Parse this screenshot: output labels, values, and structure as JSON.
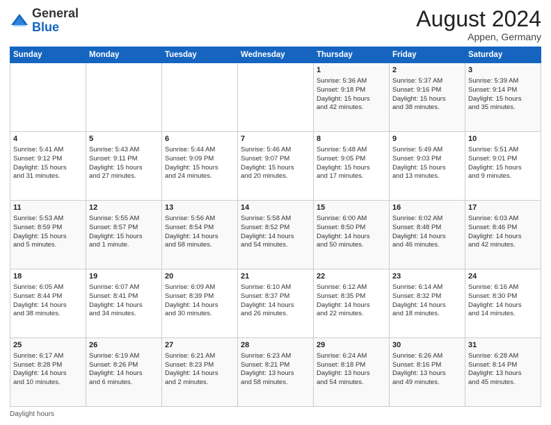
{
  "header": {
    "logo_general": "General",
    "logo_blue": "Blue",
    "month_year": "August 2024",
    "location": "Appen, Germany"
  },
  "days_of_week": [
    "Sunday",
    "Monday",
    "Tuesday",
    "Wednesday",
    "Thursday",
    "Friday",
    "Saturday"
  ],
  "weeks": [
    [
      {
        "day": "",
        "info": ""
      },
      {
        "day": "",
        "info": ""
      },
      {
        "day": "",
        "info": ""
      },
      {
        "day": "",
        "info": ""
      },
      {
        "day": "1",
        "info": "Sunrise: 5:36 AM\nSunset: 9:18 PM\nDaylight: 15 hours\nand 42 minutes."
      },
      {
        "day": "2",
        "info": "Sunrise: 5:37 AM\nSunset: 9:16 PM\nDaylight: 15 hours\nand 38 minutes."
      },
      {
        "day": "3",
        "info": "Sunrise: 5:39 AM\nSunset: 9:14 PM\nDaylight: 15 hours\nand 35 minutes."
      }
    ],
    [
      {
        "day": "4",
        "info": "Sunrise: 5:41 AM\nSunset: 9:12 PM\nDaylight: 15 hours\nand 31 minutes."
      },
      {
        "day": "5",
        "info": "Sunrise: 5:43 AM\nSunset: 9:11 PM\nDaylight: 15 hours\nand 27 minutes."
      },
      {
        "day": "6",
        "info": "Sunrise: 5:44 AM\nSunset: 9:09 PM\nDaylight: 15 hours\nand 24 minutes."
      },
      {
        "day": "7",
        "info": "Sunrise: 5:46 AM\nSunset: 9:07 PM\nDaylight: 15 hours\nand 20 minutes."
      },
      {
        "day": "8",
        "info": "Sunrise: 5:48 AM\nSunset: 9:05 PM\nDaylight: 15 hours\nand 17 minutes."
      },
      {
        "day": "9",
        "info": "Sunrise: 5:49 AM\nSunset: 9:03 PM\nDaylight: 15 hours\nand 13 minutes."
      },
      {
        "day": "10",
        "info": "Sunrise: 5:51 AM\nSunset: 9:01 PM\nDaylight: 15 hours\nand 9 minutes."
      }
    ],
    [
      {
        "day": "11",
        "info": "Sunrise: 5:53 AM\nSunset: 8:59 PM\nDaylight: 15 hours\nand 5 minutes."
      },
      {
        "day": "12",
        "info": "Sunrise: 5:55 AM\nSunset: 8:57 PM\nDaylight: 15 hours\nand 1 minute."
      },
      {
        "day": "13",
        "info": "Sunrise: 5:56 AM\nSunset: 8:54 PM\nDaylight: 14 hours\nand 58 minutes."
      },
      {
        "day": "14",
        "info": "Sunrise: 5:58 AM\nSunset: 8:52 PM\nDaylight: 14 hours\nand 54 minutes."
      },
      {
        "day": "15",
        "info": "Sunrise: 6:00 AM\nSunset: 8:50 PM\nDaylight: 14 hours\nand 50 minutes."
      },
      {
        "day": "16",
        "info": "Sunrise: 6:02 AM\nSunset: 8:48 PM\nDaylight: 14 hours\nand 46 minutes."
      },
      {
        "day": "17",
        "info": "Sunrise: 6:03 AM\nSunset: 8:46 PM\nDaylight: 14 hours\nand 42 minutes."
      }
    ],
    [
      {
        "day": "18",
        "info": "Sunrise: 6:05 AM\nSunset: 8:44 PM\nDaylight: 14 hours\nand 38 minutes."
      },
      {
        "day": "19",
        "info": "Sunrise: 6:07 AM\nSunset: 8:41 PM\nDaylight: 14 hours\nand 34 minutes."
      },
      {
        "day": "20",
        "info": "Sunrise: 6:09 AM\nSunset: 8:39 PM\nDaylight: 14 hours\nand 30 minutes."
      },
      {
        "day": "21",
        "info": "Sunrise: 6:10 AM\nSunset: 8:37 PM\nDaylight: 14 hours\nand 26 minutes."
      },
      {
        "day": "22",
        "info": "Sunrise: 6:12 AM\nSunset: 8:35 PM\nDaylight: 14 hours\nand 22 minutes."
      },
      {
        "day": "23",
        "info": "Sunrise: 6:14 AM\nSunset: 8:32 PM\nDaylight: 14 hours\nand 18 minutes."
      },
      {
        "day": "24",
        "info": "Sunrise: 6:16 AM\nSunset: 8:30 PM\nDaylight: 14 hours\nand 14 minutes."
      }
    ],
    [
      {
        "day": "25",
        "info": "Sunrise: 6:17 AM\nSunset: 8:28 PM\nDaylight: 14 hours\nand 10 minutes."
      },
      {
        "day": "26",
        "info": "Sunrise: 6:19 AM\nSunset: 8:26 PM\nDaylight: 14 hours\nand 6 minutes."
      },
      {
        "day": "27",
        "info": "Sunrise: 6:21 AM\nSunset: 8:23 PM\nDaylight: 14 hours\nand 2 minutes."
      },
      {
        "day": "28",
        "info": "Sunrise: 6:23 AM\nSunset: 8:21 PM\nDaylight: 13 hours\nand 58 minutes."
      },
      {
        "day": "29",
        "info": "Sunrise: 6:24 AM\nSunset: 8:18 PM\nDaylight: 13 hours\nand 54 minutes."
      },
      {
        "day": "30",
        "info": "Sunrise: 6:26 AM\nSunset: 8:16 PM\nDaylight: 13 hours\nand 49 minutes."
      },
      {
        "day": "31",
        "info": "Sunrise: 6:28 AM\nSunset: 8:14 PM\nDaylight: 13 hours\nand 45 minutes."
      }
    ]
  ],
  "footer": {
    "daylight_label": "Daylight hours"
  }
}
